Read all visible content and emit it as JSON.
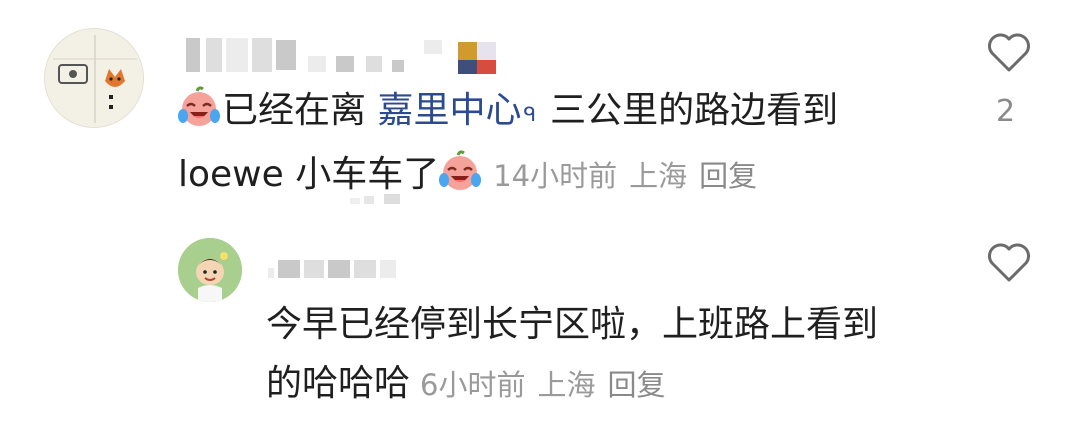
{
  "comment": {
    "text_line1": "已经在离",
    "mention": "嘉里中心",
    "search_glyph": "ᑫ",
    "text_line1_rest": "三公里的路边看到",
    "text_line2": "loewe 小车车了",
    "time": "14小时前",
    "location": "上海",
    "reply_label": "回复",
    "like_count": "2",
    "emoji_icon": "crying-laughing-face-icon"
  },
  "reply": {
    "text_line1": "今早已经停到长宁区啦，上班路上看到",
    "text_line2": "的哈哈哈",
    "time": "6小时前",
    "location": "上海",
    "reply_label": "回复"
  },
  "colors": {
    "mention": "#2b4a8f",
    "meta": "#9a9a9a",
    "text": "#1f1f1f"
  }
}
